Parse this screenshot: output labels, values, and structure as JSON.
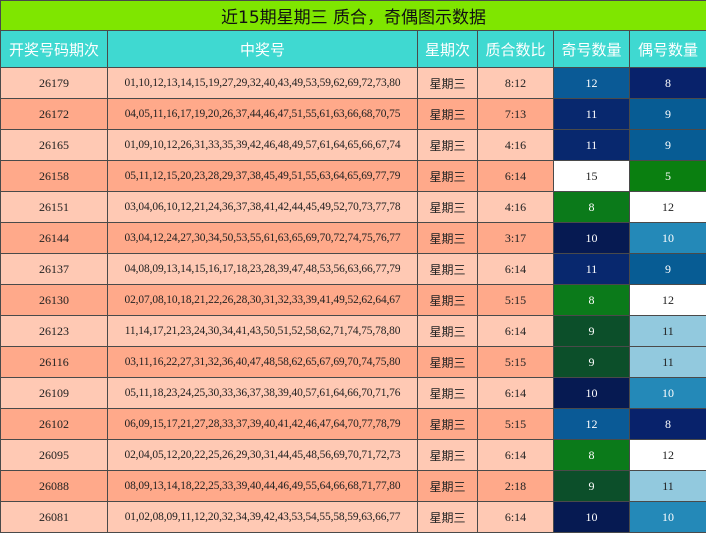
{
  "title": "近15期星期三 质合，奇偶图示数据",
  "headers": [
    "开奖号码期次",
    "中奖号",
    "星期次",
    "质合数比",
    "奇号数量",
    "偶号数量"
  ],
  "colors": {
    "title_bg": "#7fe600",
    "header_bg": "#3fd9d1",
    "row_light": "#ffc9b4",
    "row_dark": "#ffa98a",
    "count_scale": {
      "5": "#008000",
      "8": "#0b6e14",
      "9": "#005a8c",
      "10": "#0f2a6b",
      "11": "#94cbe0",
      "12": "#ffffff",
      "15": "#ffffff"
    }
  },
  "rows": [
    {
      "period": "26179",
      "numbers": "01,10,12,13,14,15,19,27,29,32,40,43,49,53,59,62,69,72,73,80",
      "weekday": "星期三",
      "ratio": "8:12",
      "odd": "12",
      "even": "8",
      "odd_bg": "#0a5a96",
      "even_bg": "#08226b",
      "odd_fg": "#ffffff",
      "even_fg": "#ffffff"
    },
    {
      "period": "26172",
      "numbers": "04,05,11,16,17,19,20,26,37,44,46,47,51,55,61,63,66,68,70,75",
      "weekday": "星期三",
      "ratio": "7:13",
      "odd": "11",
      "even": "9",
      "odd_bg": "#08286e",
      "even_bg": "#075c94",
      "odd_fg": "#ffffff",
      "even_fg": "#ffffff"
    },
    {
      "period": "26165",
      "numbers": "01,09,10,12,26,31,33,35,39,42,46,48,49,57,61,64,65,66,67,74",
      "weekday": "星期三",
      "ratio": "4:16",
      "odd": "11",
      "even": "9",
      "odd_bg": "#08286e",
      "even_bg": "#075c94",
      "odd_fg": "#ffffff",
      "even_fg": "#ffffff"
    },
    {
      "period": "26158",
      "numbers": "05,11,12,15,20,23,28,29,37,38,45,49,51,55,63,64,65,69,77,79",
      "weekday": "星期三",
      "ratio": "6:14",
      "odd": "15",
      "even": "5",
      "odd_bg": "#ffffff",
      "even_bg": "#0a7f10",
      "odd_fg": "#222222",
      "even_fg": "#ffffff"
    },
    {
      "period": "26151",
      "numbers": "03,04,06,10,12,21,24,36,37,38,41,42,44,45,49,52,70,73,77,78",
      "weekday": "星期三",
      "ratio": "4:16",
      "odd": "8",
      "even": "12",
      "odd_bg": "#0b7a1a",
      "even_bg": "#ffffff",
      "odd_fg": "#ffffff",
      "even_fg": "#222222"
    },
    {
      "period": "26144",
      "numbers": "03,04,12,24,27,30,34,50,53,55,61,63,65,69,70,72,74,75,76,77",
      "weekday": "星期三",
      "ratio": "3:17",
      "odd": "10",
      "even": "10",
      "odd_bg": "#061a52",
      "even_bg": "#2489b8",
      "odd_fg": "#ffffff",
      "even_fg": "#ffffff"
    },
    {
      "period": "26137",
      "numbers": "04,08,09,13,14,15,16,17,18,23,28,39,47,48,53,56,63,66,77,79",
      "weekday": "星期三",
      "ratio": "6:14",
      "odd": "11",
      "even": "9",
      "odd_bg": "#08286e",
      "even_bg": "#075c94",
      "odd_fg": "#ffffff",
      "even_fg": "#ffffff"
    },
    {
      "period": "26130",
      "numbers": "02,07,08,10,18,21,22,26,28,30,31,32,33,39,41,49,52,62,64,67",
      "weekday": "星期三",
      "ratio": "5:15",
      "odd": "8",
      "even": "12",
      "odd_bg": "#0b7a1a",
      "even_bg": "#ffffff",
      "odd_fg": "#ffffff",
      "even_fg": "#222222"
    },
    {
      "period": "26123",
      "numbers": "11,14,17,21,23,24,30,34,41,43,50,51,52,58,62,71,74,75,78,80",
      "weekday": "星期三",
      "ratio": "6:14",
      "odd": "9",
      "even": "11",
      "odd_bg": "#0c4f2a",
      "even_bg": "#92c9de",
      "odd_fg": "#ffffff",
      "even_fg": "#222222"
    },
    {
      "period": "26116",
      "numbers": "03,11,16,22,27,31,32,36,40,47,48,58,62,65,67,69,70,74,75,80",
      "weekday": "星期三",
      "ratio": "5:15",
      "odd": "9",
      "even": "11",
      "odd_bg": "#0c4f2a",
      "even_bg": "#92c9de",
      "odd_fg": "#ffffff",
      "even_fg": "#222222"
    },
    {
      "period": "26109",
      "numbers": "05,11,18,23,24,25,30,33,36,37,38,39,40,57,61,64,66,70,71,76",
      "weekday": "星期三",
      "ratio": "6:14",
      "odd": "10",
      "even": "10",
      "odd_bg": "#061a52",
      "even_bg": "#2489b8",
      "odd_fg": "#ffffff",
      "even_fg": "#ffffff"
    },
    {
      "period": "26102",
      "numbers": "06,09,15,17,21,27,28,33,37,39,40,41,42,46,47,64,70,77,78,79",
      "weekday": "星期三",
      "ratio": "5:15",
      "odd": "12",
      "even": "8",
      "odd_bg": "#0a5a96",
      "even_bg": "#08226b",
      "odd_fg": "#ffffff",
      "even_fg": "#ffffff"
    },
    {
      "period": "26095",
      "numbers": "02,04,05,12,20,22,25,26,29,30,31,44,45,48,56,69,70,71,72,73",
      "weekday": "星期三",
      "ratio": "6:14",
      "odd": "8",
      "even": "12",
      "odd_bg": "#0b7a1a",
      "even_bg": "#ffffff",
      "odd_fg": "#ffffff",
      "even_fg": "#222222"
    },
    {
      "period": "26088",
      "numbers": "08,09,13,14,18,22,25,33,39,40,44,46,49,55,64,66,68,71,77,80",
      "weekday": "星期三",
      "ratio": "2:18",
      "odd": "9",
      "even": "11",
      "odd_bg": "#0c4f2a",
      "even_bg": "#92c9de",
      "odd_fg": "#ffffff",
      "even_fg": "#222222"
    },
    {
      "period": "26081",
      "numbers": "01,02,08,09,11,12,20,32,34,39,42,43,53,54,55,58,59,63,66,77",
      "weekday": "星期三",
      "ratio": "6:14",
      "odd": "10",
      "even": "10",
      "odd_bg": "#061a52",
      "even_bg": "#2489b8",
      "odd_fg": "#ffffff",
      "even_fg": "#ffffff"
    }
  ]
}
